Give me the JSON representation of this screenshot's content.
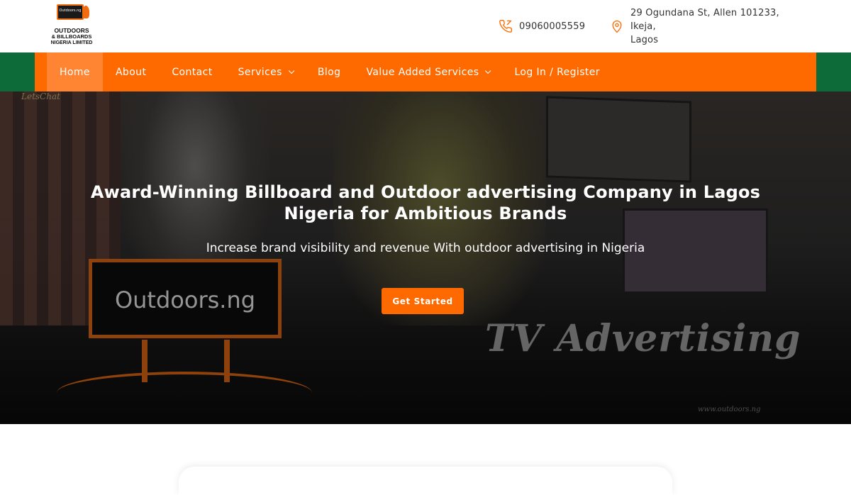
{
  "brand": {
    "sign_text": "Outdoors.ng",
    "line1": "OUTDOORS",
    "line2": "& BILLBOARDS",
    "line3": "NIGERIA LIMITED"
  },
  "contact": {
    "phone": "09060005559",
    "address_line1": "29 Ogundana St, Allen 101233, Ikeja,",
    "address_line2": "Lagos",
    "phone_icon": "phone-icon",
    "address_icon": "map-pin-icon"
  },
  "nav": {
    "items": [
      {
        "label": "Home",
        "active": true
      },
      {
        "label": "About"
      },
      {
        "label": "Contact"
      },
      {
        "label": "Services",
        "dropdown": true
      },
      {
        "label": "Blog"
      },
      {
        "label": "Value Added Services",
        "dropdown": true
      },
      {
        "label": "Log In / Register"
      }
    ]
  },
  "hero": {
    "title": "Award-Winning Billboard and Outdoor advertising Company in Lagos Nigeria for Ambitious Brands",
    "subtitle": "Increase brand visibility and revenue With outdoor advertising in Nigeria",
    "cta_label": "Get Started",
    "image_text": {
      "billboard": "Outdoors.ng",
      "banner": "TV Advertising",
      "watermark": "www.outdoors.ng",
      "chip": "LetsChat"
    }
  },
  "colors": {
    "accent": "#ff6a00",
    "nav_edge": "#0d6b3a",
    "active_nav": "#ff8533"
  }
}
